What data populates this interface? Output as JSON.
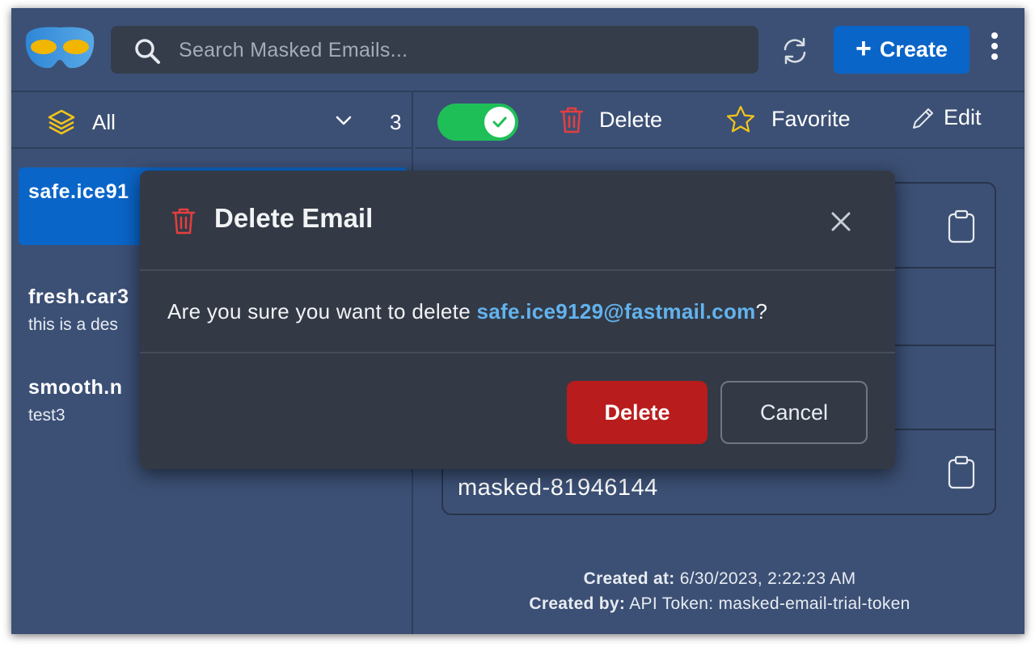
{
  "search": {
    "placeholder": "Search Masked Emails..."
  },
  "toolbar": {
    "create_label": "Create"
  },
  "filter": {
    "label": "All",
    "count": "3"
  },
  "emails": [
    {
      "address": "safe.ice91",
      "description": ""
    },
    {
      "address": "fresh.car3",
      "description": "this is a des"
    },
    {
      "address": "smooth.n",
      "description": "test3"
    }
  ],
  "actions": {
    "toggle_enabled": true,
    "delete_label": "Delete",
    "favorite_label": "Favorite",
    "edit_label": "Edit"
  },
  "detail": {
    "last_value": "masked-81946144",
    "created_at_label": "Created at:",
    "created_at": "6/30/2023, 2:22:23 AM",
    "created_by_label": "Created by:",
    "created_by": "API Token: masked-email-trial-token"
  },
  "modal": {
    "title": "Delete Email",
    "message_prefix": "Are you sure you want to delete ",
    "email": "safe.ice9129@fastmail.com",
    "message_suffix": "?",
    "delete_label": "Delete",
    "cancel_label": "Cancel"
  },
  "colors": {
    "accent": "#0a65c8",
    "danger": "#b91c1c",
    "success": "#1fbf58",
    "link": "#63b3ed",
    "favorite": "#f5c518"
  }
}
